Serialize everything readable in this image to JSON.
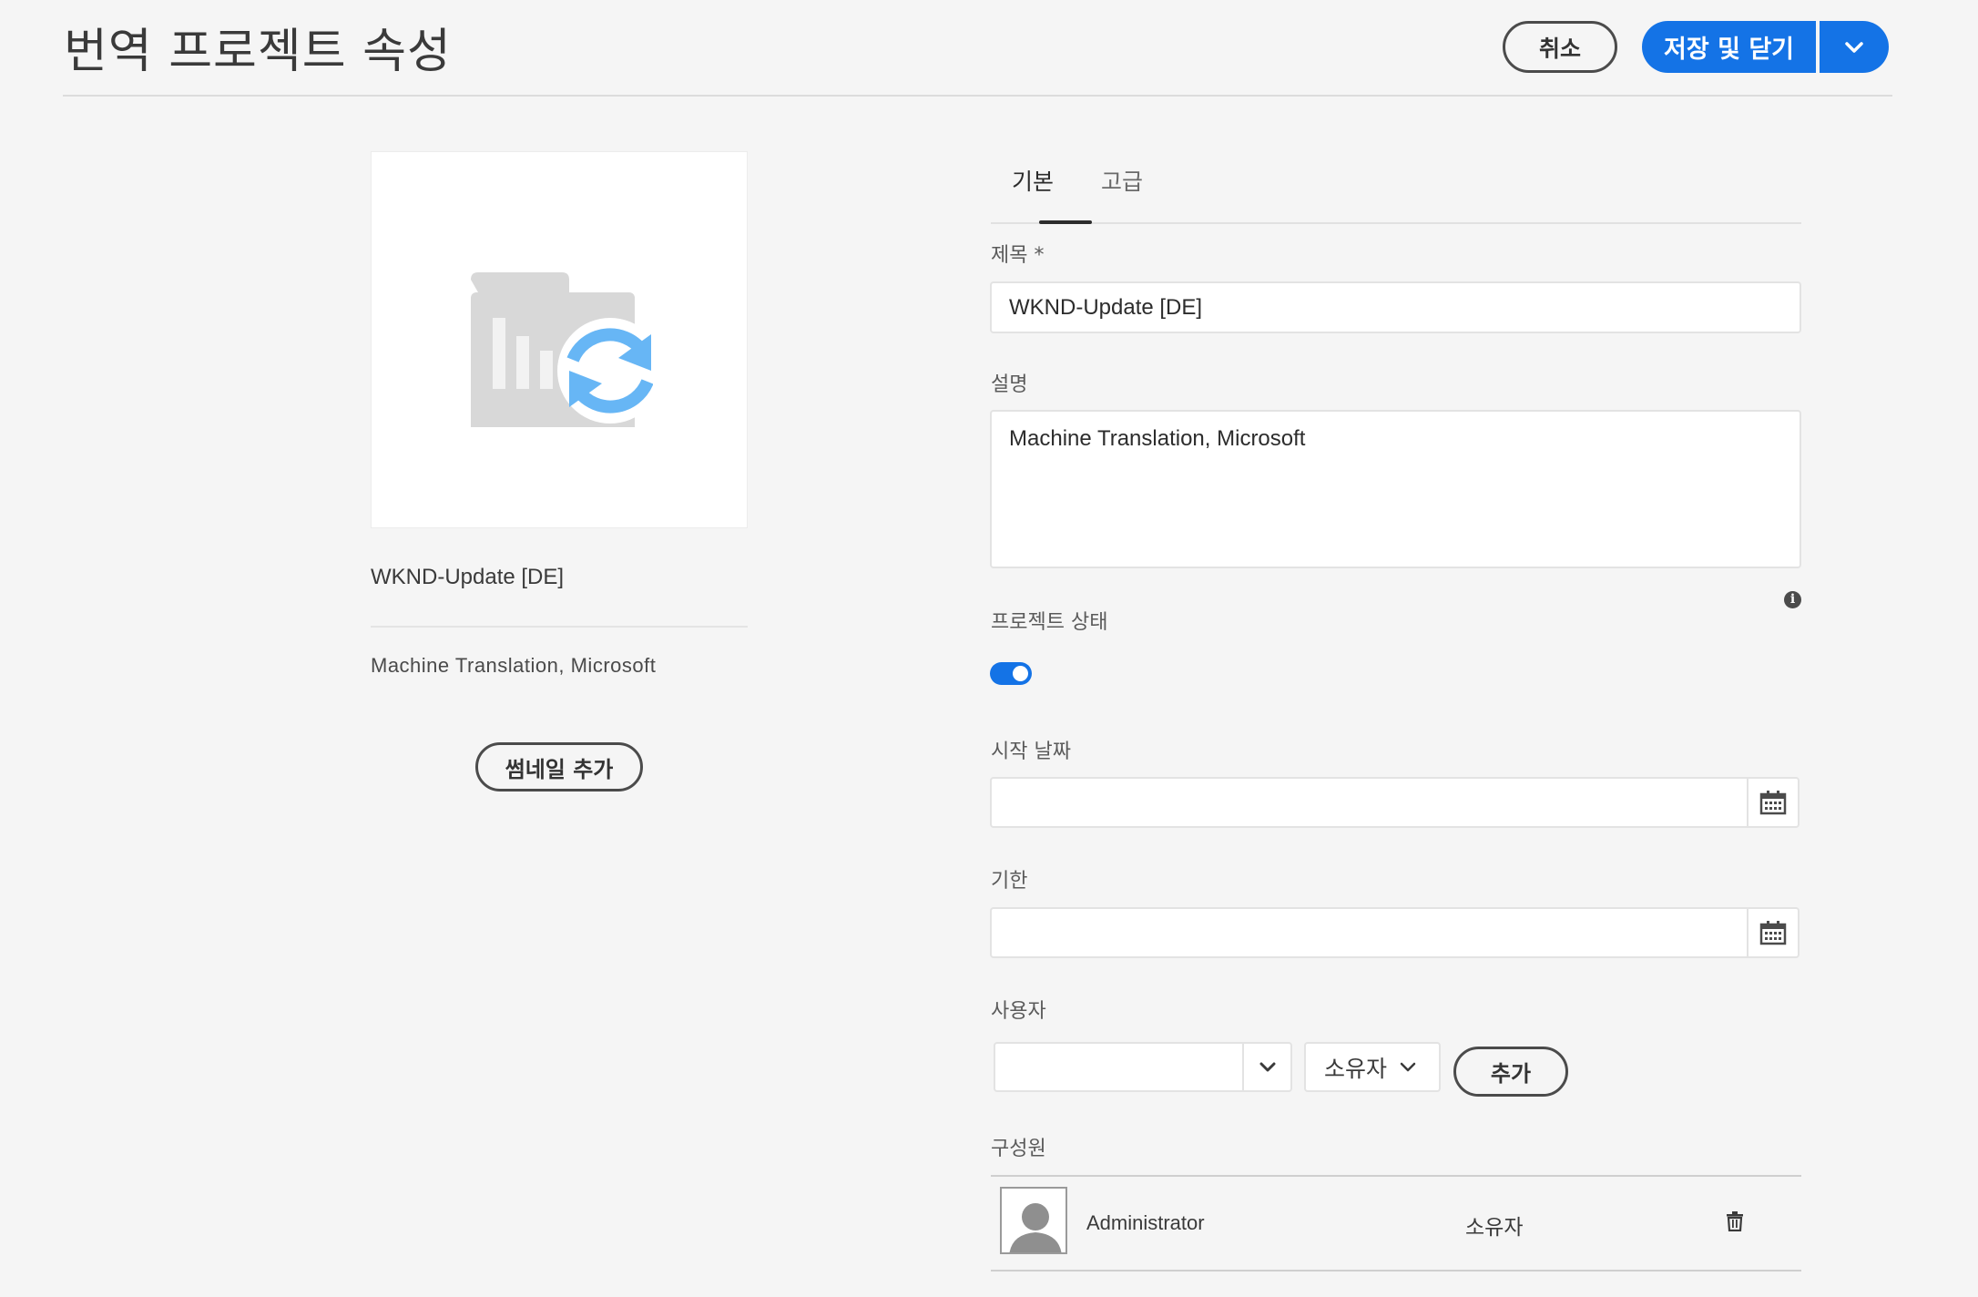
{
  "header": {
    "title": "번역 프로젝트 속성",
    "cancel_label": "취소",
    "save_label": "저장 및 닫기"
  },
  "summary": {
    "title": "WKND-Update [DE]",
    "description": "Machine Translation, Microsoft",
    "add_thumbnail_label": "썸네일 추가"
  },
  "tabs": [
    {
      "label": "기본",
      "selected": true
    },
    {
      "label": "고급",
      "selected": false
    }
  ],
  "form": {
    "title_label": "제목 *",
    "title_value": "WKND-Update [DE]",
    "description_label": "설명",
    "description_value": "Machine Translation, Microsoft",
    "status_label": "프로젝트 상태",
    "status_on": true,
    "start_date_label": "시작 날짜",
    "start_date_value": "",
    "due_date_label": "기한",
    "due_date_value": "",
    "user_label": "사용자",
    "user_value": "",
    "role_value": "소유자",
    "add_label": "추가",
    "members_label": "구성원"
  },
  "members": [
    {
      "name": "Administrator",
      "role": "소유자"
    }
  ],
  "icons": {
    "save_menu": "chevron-down-icon",
    "info": "info-icon",
    "calendar": "calendar-icon",
    "delete": "trash-icon",
    "thumbnail": "translation-project-icon"
  },
  "colors": {
    "accent": "#1473e6",
    "thumbnail_sync": "#67b6f5"
  }
}
